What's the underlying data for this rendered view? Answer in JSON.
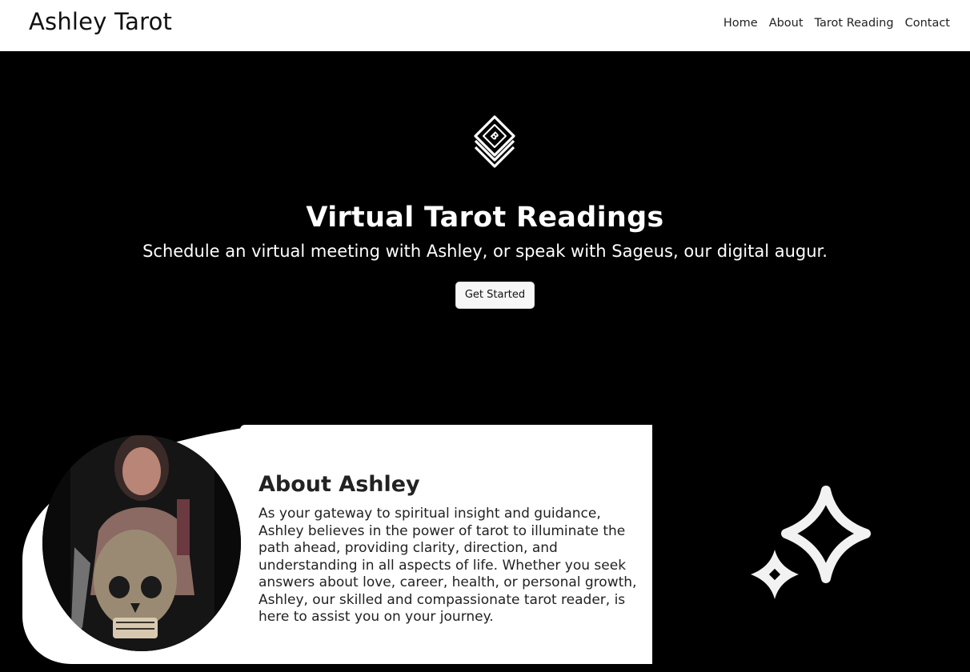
{
  "header": {
    "brand": "Ashley Tarot",
    "nav": [
      "Home",
      "About",
      "Tarot Reading",
      "Contact"
    ]
  },
  "hero": {
    "icon": "tarot-cards-icon",
    "title": "Virtual Tarot Readings",
    "subtitle": "Schedule an virtual meeting with Ashley, or speak with Sageus, our digital augur.",
    "cta_label": "Get Started"
  },
  "about": {
    "title": "About Ashley",
    "body": "As your gateway to spiritual insight and guidance, Ashley believes in the power of tarot to illuminate the path ahead, providing clarity, direction, and understanding in all aspects of life. Whether you seek answers about love, career, health, or personal growth, Ashley, our skilled and compassionate tarot reader, is here to assist you on your journey.",
    "photo": "ashley-portrait",
    "decoration": "sparkle-icon"
  },
  "colors": {
    "background": "#000000",
    "navbar": "#ffffff",
    "card": "#ffffff",
    "text_dark": "#222222"
  }
}
